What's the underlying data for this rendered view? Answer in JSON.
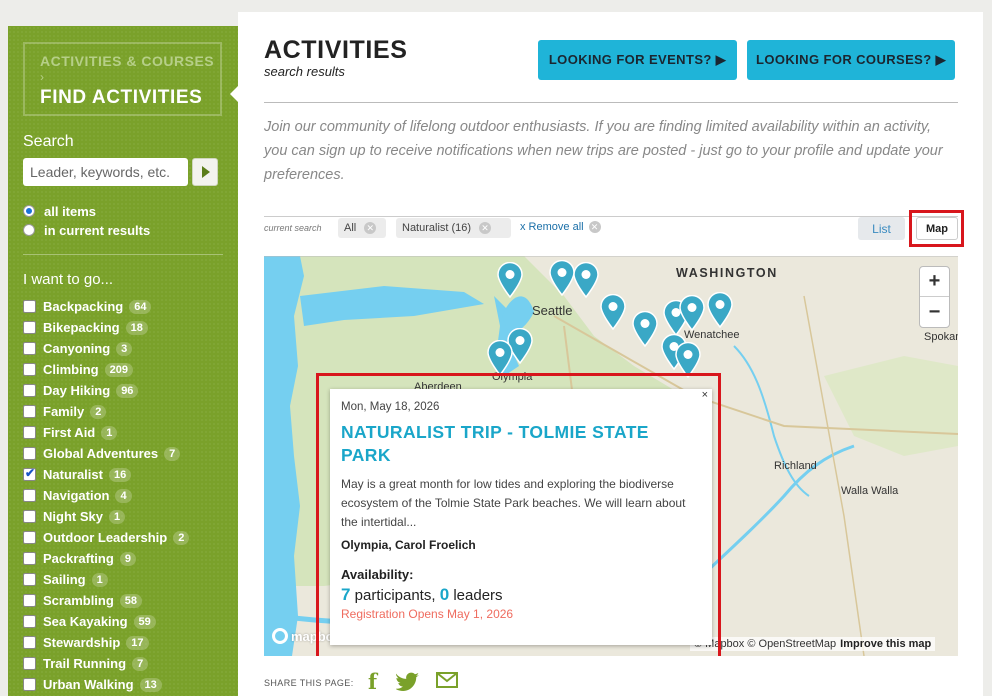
{
  "sidebar": {
    "crumb_parent": "ACTIVITIES & COURSES",
    "crumb_sep": "›",
    "crumb_current": "FIND ACTIVITIES",
    "search_label": "Search",
    "search_placeholder": "Leader, keywords, etc.",
    "scope_options": [
      {
        "label": "all items",
        "selected": true
      },
      {
        "label": "in current results",
        "selected": false
      }
    ],
    "want_label": "I want to go...",
    "categories": [
      {
        "label": "Backpacking",
        "count": "64",
        "checked": false
      },
      {
        "label": "Bikepacking",
        "count": "18",
        "checked": false
      },
      {
        "label": "Canyoning",
        "count": "3",
        "checked": false
      },
      {
        "label": "Climbing",
        "count": "209",
        "checked": false
      },
      {
        "label": "Day Hiking",
        "count": "96",
        "checked": false
      },
      {
        "label": "Family",
        "count": "2",
        "checked": false
      },
      {
        "label": "First Aid",
        "count": "1",
        "checked": false
      },
      {
        "label": "Global Adventures",
        "count": "7",
        "checked": false
      },
      {
        "label": "Naturalist",
        "count": "16",
        "checked": true
      },
      {
        "label": "Navigation",
        "count": "4",
        "checked": false
      },
      {
        "label": "Night Sky",
        "count": "1",
        "checked": false
      },
      {
        "label": "Outdoor Leadership",
        "count": "2",
        "checked": false
      },
      {
        "label": "Packrafting",
        "count": "9",
        "checked": false
      },
      {
        "label": "Sailing",
        "count": "1",
        "checked": false
      },
      {
        "label": "Scrambling",
        "count": "58",
        "checked": false
      },
      {
        "label": "Sea Kayaking",
        "count": "59",
        "checked": false
      },
      {
        "label": "Stewardship",
        "count": "17",
        "checked": false
      },
      {
        "label": "Trail Running",
        "count": "7",
        "checked": false
      },
      {
        "label": "Urban Walking",
        "count": "13",
        "checked": false
      }
    ]
  },
  "header": {
    "title": "ACTIVITIES",
    "subtitle": "search results",
    "events_button": "LOOKING FOR EVENTS? ▶",
    "courses_button": "LOOKING FOR COURSES? ▶"
  },
  "intro": "Join our community of lifelong outdoor enthusiasts. If you are finding limited availability within an activity, you can sign up to receive notifications when new trips are posted - just go to your profile and update your preferences.",
  "filters": {
    "current_search_label": "current search",
    "chips": [
      "All",
      "Naturalist (16)"
    ],
    "remove_all": "x Remove all",
    "list_label": "List",
    "map_label": "Map"
  },
  "map": {
    "labels": {
      "washington": "WASHINGTON",
      "seattle": "Seattle",
      "wenatchee": "Wenatchee",
      "aberdeen": "Aberdeen",
      "olympia": "Olympia",
      "richland": "Richland",
      "walla_walla": "Walla Walla",
      "spokane": "Spokan"
    },
    "zoom_in": "+",
    "zoom_out": "−",
    "logo": "mapbox",
    "attribution": "© Mapbox © OpenStreetMap",
    "improve": "Improve this map",
    "colors": {
      "water": "#75cff0",
      "land": "#ebe8dc",
      "green": "#cfe0b4",
      "pin": "#3aa8c6"
    }
  },
  "popup": {
    "close": "×",
    "date": "Mon, May 18, 2026",
    "title": "NATURALIST TRIP - TOLMIE STATE PARK",
    "description": "May is a great month for low tides and exploring the biodiverse ecosystem of the Tolmie State Park beaches. We will learn about the intertidal...",
    "leader": "Olympia, Carol Froelich",
    "availability_label": "Availability:",
    "participants": "7",
    "participants_label": "participants,",
    "leaders": "0",
    "leaders_label": "leaders",
    "registration": "Registration Opens May 1, 2026"
  },
  "share": {
    "label": "SHARE THIS PAGE:",
    "icons": [
      "facebook-icon",
      "twitter-icon",
      "email-icon"
    ]
  },
  "colors": {
    "sidebar_green": "#7aa12a",
    "accent_blue": "#1fb4d8",
    "link_blue": "#1aa6c9",
    "highlight_red": "#d8161c",
    "reg_red": "#ef6c5f"
  }
}
